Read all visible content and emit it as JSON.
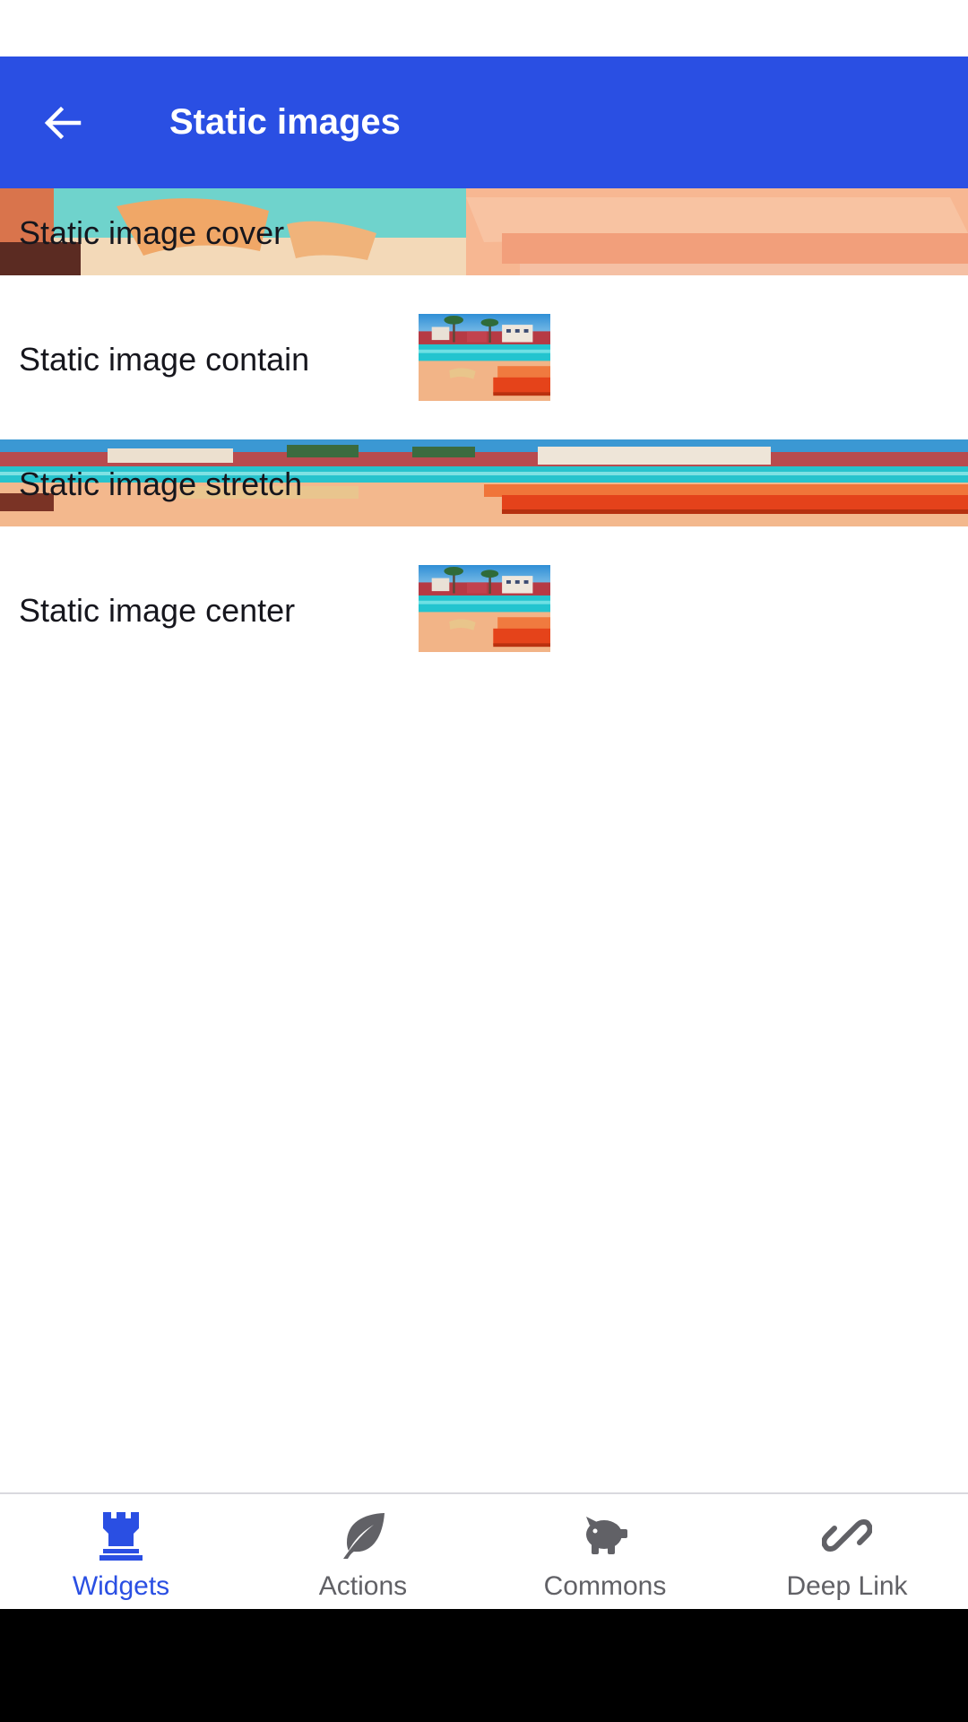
{
  "app_bar": {
    "title": "Static images",
    "background": "#2a4fe3",
    "back_icon": "arrow-left-icon"
  },
  "rows": [
    {
      "label": "Static image cover",
      "mode": "cover"
    },
    {
      "label": "Static image contain",
      "mode": "contain"
    },
    {
      "label": "Static image stretch",
      "mode": "stretch"
    },
    {
      "label": "Static image center",
      "mode": "center"
    }
  ],
  "bottom_nav": {
    "items": [
      {
        "label": "Widgets",
        "icon": "castle-rook-icon",
        "active": true
      },
      {
        "label": "Actions",
        "icon": "leaf-icon",
        "active": false
      },
      {
        "label": "Commons",
        "icon": "piggy-bank-icon",
        "active": false
      },
      {
        "label": "Deep Link",
        "icon": "link-icon",
        "active": false
      }
    ],
    "active_color": "#2a4fe3",
    "inactive_color": "#616166"
  }
}
